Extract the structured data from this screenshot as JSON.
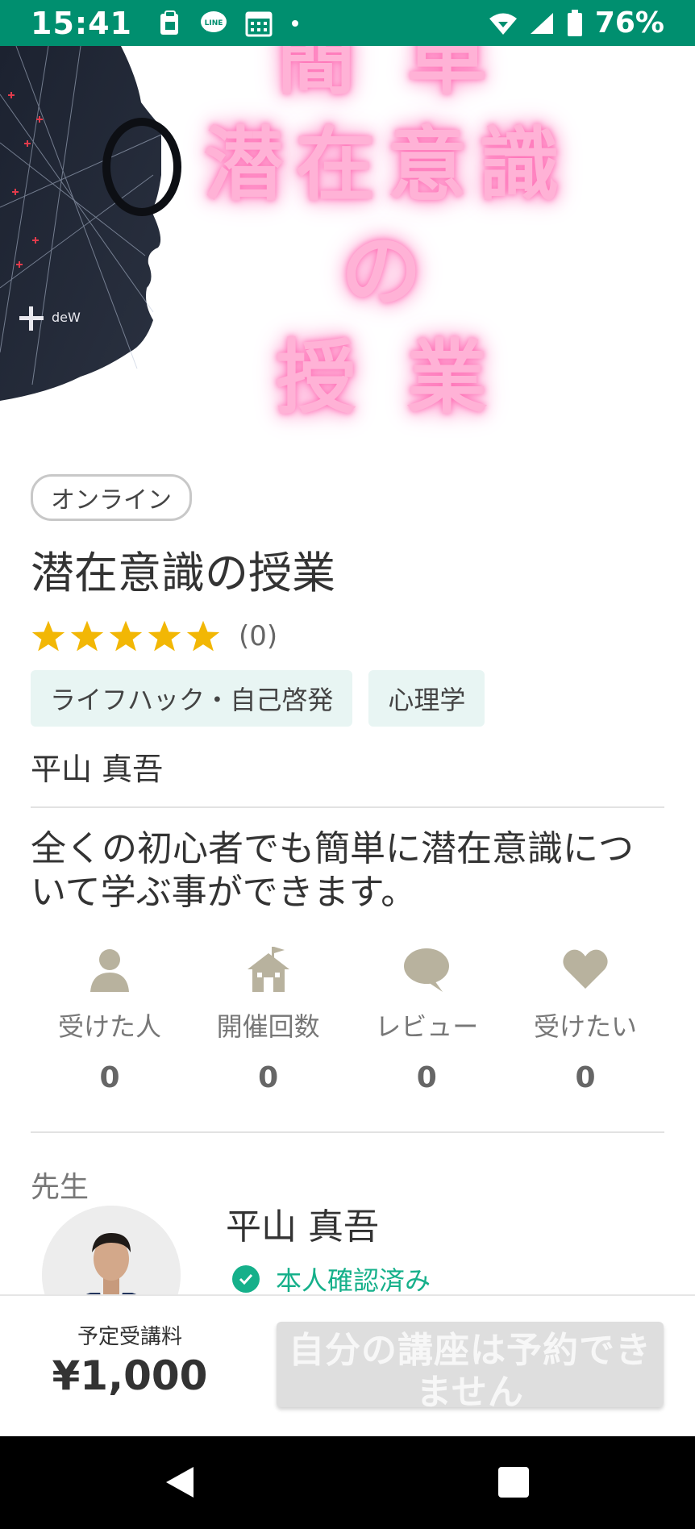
{
  "status_bar": {
    "time": "15:41",
    "battery_text": "76%",
    "icons": [
      "clipboard-icon",
      "line-app-icon",
      "calendar-icon",
      "dot-icon",
      "wifi-icon",
      "signal-icon",
      "battery-icon"
    ]
  },
  "hero": {
    "title_lines": [
      "簡 単",
      "潜在意識の",
      "授 業"
    ],
    "banner_label": "deW"
  },
  "course": {
    "format_tag": "オンライン",
    "title": "潜在意識の授業",
    "rating_count": "(0)",
    "stars": 5,
    "tags": [
      "ライフハック・自己啓発",
      "心理学"
    ],
    "teacher_name": "平山 真吾",
    "description": "全くの初心者でも簡単に潜在意識について学ぶ事ができます。"
  },
  "stats": [
    {
      "icon": "person-icon",
      "label": "受けた人",
      "value": "0"
    },
    {
      "icon": "school-house-icon",
      "label": "開催回数",
      "value": "0"
    },
    {
      "icon": "speech-bubble-icon",
      "label": "レビュー",
      "value": "0"
    },
    {
      "icon": "heart-icon",
      "label": "受けたい",
      "value": "0"
    }
  ],
  "teacher_section": {
    "label": "先生",
    "name": "平山 真吾",
    "verified_text": "本人確認済み"
  },
  "booking": {
    "price_label": "予定受講料",
    "price": "¥1,000",
    "button_label": "自分の講座は予約できません"
  },
  "colors": {
    "status_bar": "#008f6f",
    "accent_green": "#15b08a",
    "star_yellow": "#f2b705",
    "neon_pink": "#ff8ec7",
    "tag_bg": "#e8f5f3"
  }
}
